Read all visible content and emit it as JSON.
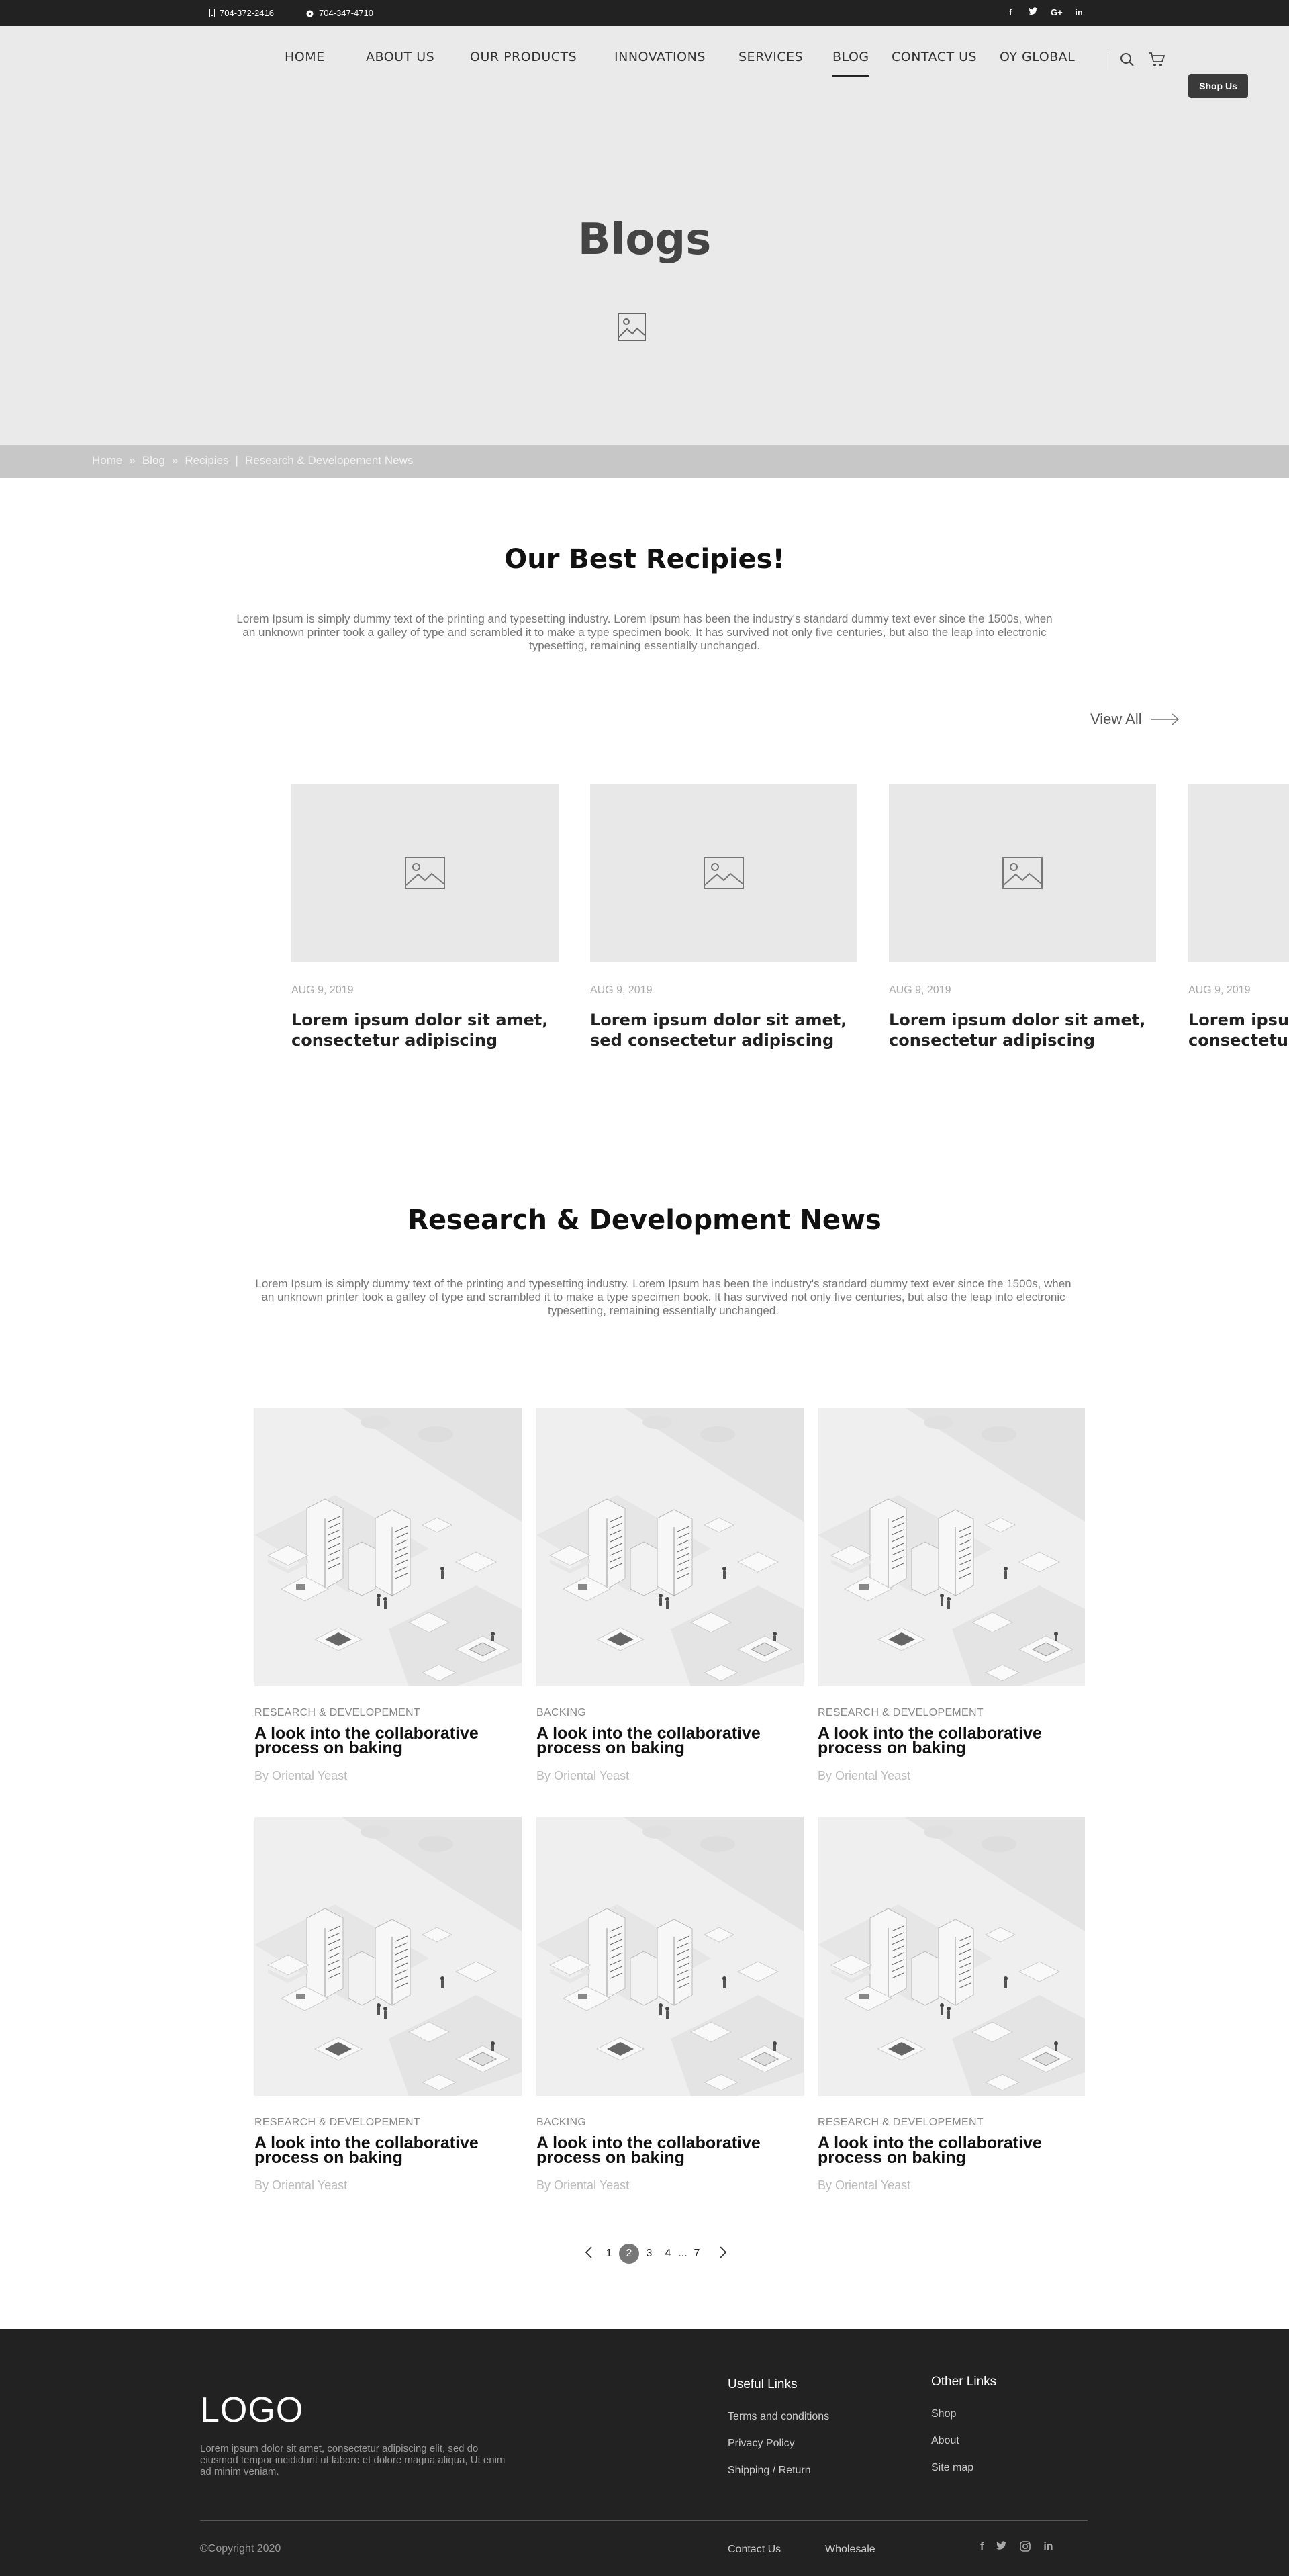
{
  "topbar": {
    "phone1": "704-372-2416",
    "phone2": "704-347-4710",
    "social": [
      "f",
      "t",
      "G+",
      "in"
    ]
  },
  "nav": {
    "items": [
      {
        "label": "HOME"
      },
      {
        "label": "ABOUT US"
      },
      {
        "label": "OUR PRODUCTS"
      },
      {
        "label": "INNOVATIONS"
      },
      {
        "label": "SERVICES"
      },
      {
        "label": "BLOG",
        "active": true
      },
      {
        "label": "CONTACT US"
      },
      {
        "label": "OY GLOBAL"
      }
    ],
    "shop_button": "Shop Us"
  },
  "hero": {
    "title": "Blogs"
  },
  "breadcrumb": {
    "items": [
      "Home",
      "»",
      "Blog",
      "»",
      "Recipies",
      "|",
      "Research & Developement News"
    ]
  },
  "recipes": {
    "title": "Our Best Recipies!",
    "desc": "Lorem Ipsum is simply dummy text of the printing and typesetting industry. Lorem Ipsum has been the industry's standard dummy text ever since the 1500s, when an unknown printer took a galley of type and scrambled it to make a type specimen book. It has survived not only five centuries, but also the leap into electronic typesetting, remaining essentially unchanged.",
    "view_all": "View All",
    "cards": [
      {
        "date": "AUG 9, 2019",
        "title": "Lorem ipsum dolor sit amet, consectetur adipiscing"
      },
      {
        "date": "AUG 9, 2019",
        "title": "Lorem ipsum dolor sit amet, sed consectetur adipiscing"
      },
      {
        "date": "AUG 9, 2019",
        "title": "Lorem ipsum dolor sit amet, consectetur adipiscing"
      },
      {
        "date": "AUG 9, 2019",
        "title": "Lorem ipsum dolor sit amet, consectetur adipiscing"
      }
    ]
  },
  "news": {
    "title": "Research & Development News",
    "desc": "Lorem Ipsum is simply dummy text of the printing and typesetting industry. Lorem Ipsum has been the industry's standard dummy text ever since the 1500s, when an unknown printer took a galley of type and scrambled it to make a type specimen book. It has survived not only five centuries, but also the leap into electronic typesetting, remaining essentially unchanged.",
    "articles": [
      {
        "category": "RESEARCH & DEVELOPEMENT",
        "title": "A look into the collaborative process on baking",
        "author": "By Oriental Yeast"
      },
      {
        "category": "BACKING",
        "title": "A look into the collaborative process on baking",
        "author": "By Oriental Yeast"
      },
      {
        "category": "RESEARCH & DEVELOPEMENT",
        "title": "A look into the collaborative process on baking",
        "author": "By Oriental Yeast"
      },
      {
        "category": "RESEARCH & DEVELOPEMENT",
        "title": "A look into the collaborative process on baking",
        "author": "By Oriental Yeast"
      },
      {
        "category": "BACKING",
        "title": "A look into the collaborative process on baking",
        "author": "By Oriental Yeast"
      },
      {
        "category": "RESEARCH & DEVELOPEMENT",
        "title": "A look into the collaborative process on baking",
        "author": "By Oriental Yeast"
      }
    ]
  },
  "pagination": {
    "pages": [
      "1",
      "2",
      "3",
      "4",
      "...",
      "7"
    ],
    "current": "2"
  },
  "footer": {
    "logo": "LOGO",
    "desc": "Lorem ipsum dolor sit amet, consectetur adipiscing elit, sed do eiusmod tempor incididunt ut labore et dolore magna aliqua, Ut enim ad minim veniam.",
    "useful_title": "Useful Links",
    "useful_links": [
      "Terms and conditions",
      "Privacy Policy",
      "Shipping / Return"
    ],
    "other_title": "Other Links",
    "other_links": [
      "Shop",
      "About",
      "Site map"
    ],
    "copyright": "©Copyright 2020",
    "bottom_links": [
      "Contact Us",
      "Wholesale"
    ],
    "social": [
      "f",
      "t",
      "ig",
      "in"
    ]
  }
}
